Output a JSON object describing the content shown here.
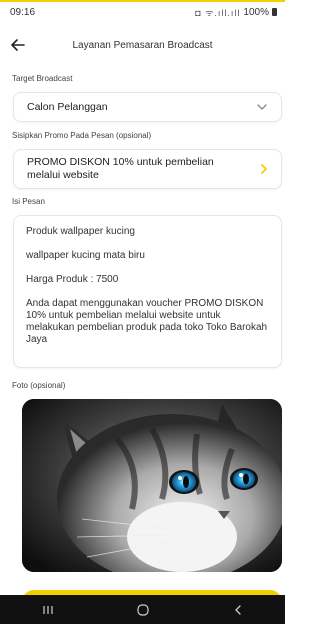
{
  "status": {
    "time": "09:16",
    "battery": "100%",
    "icons": "◘ ᯤ.ıll.ıll"
  },
  "header": {
    "title": "Layanan Pemasaran Broadcast",
    "back_icon": "arrow-left-icon"
  },
  "target": {
    "label": "Target Broadcast",
    "value": "Calon Pelanggan",
    "icon": "chevron-down-icon"
  },
  "promo": {
    "label": "Sisipkan Promo Pada Pesan (opsional)",
    "value": "PROMO DISKON 10% untuk pembelian melalui website",
    "icon": "chevron-right-icon"
  },
  "message": {
    "label": "Isi Pesan",
    "lines": [
      "Produk wallpaper kucing",
      "wallpaper kucing mata biru",
      "Harga Produk : 7500",
      "Anda dapat menggunakan voucher PROMO DISKON 10% untuk pembelian melalui website untuk melakukan pembelian produk pada toko Toko Barokah Jaya"
    ]
  },
  "photo": {
    "label": "Foto (opsional)"
  },
  "colors": {
    "accent": "#f3cf00",
    "eye": "#29a8e8"
  },
  "nav": {
    "recent_icon": "recent-apps-icon",
    "home_icon": "home-icon",
    "back_icon": "back-triangle-icon"
  }
}
